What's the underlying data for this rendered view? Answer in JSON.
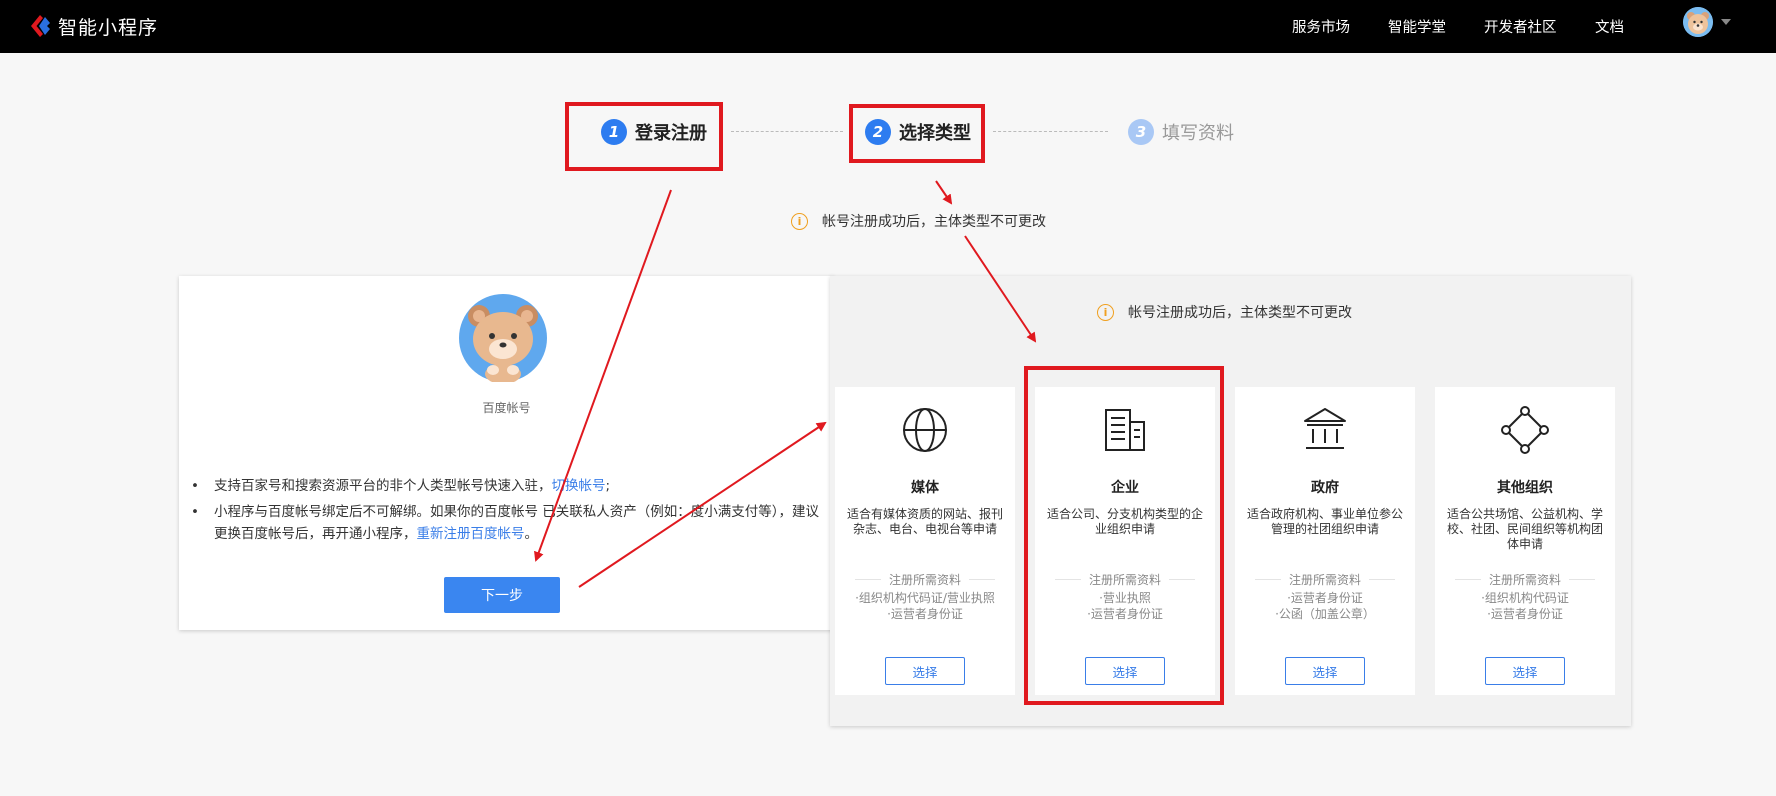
{
  "header": {
    "brand": "智能小程序",
    "nav": [
      "服务市场",
      "智能学堂",
      "开发者社区",
      "文档"
    ]
  },
  "steps": [
    {
      "num": "1",
      "label": "登录注册",
      "state": "done"
    },
    {
      "num": "2",
      "label": "选择类型",
      "state": "active"
    },
    {
      "num": "3",
      "label": "填写资料",
      "state": "pending"
    }
  ],
  "notice": "帐号注册成功后，主体类型不可更改",
  "login_panel": {
    "account_name": "百度帐号",
    "bullet1_text": "支持百家号和搜索资源平台的非个人类型帐号快速入驻，",
    "bullet1_link": "切换帐号",
    "bullet1_end": ";",
    "bullet2_text": "小程序与百度帐号绑定后不可解绑。如果你的百度帐号          已关联私人资产（例如：度小满支付等），建议更换百度帐号后，再开通小程序，",
    "bullet2_link": "重新注册百度帐号",
    "bullet2_end": "。",
    "next_button": "下一步"
  },
  "type_panel": {
    "notice": "帐号注册成功后，主体类型不可更改",
    "required_label": "注册所需资料",
    "cards": [
      {
        "icon": "globe-icon",
        "title": "媒体",
        "desc": "适合有媒体资质的网站、报刊杂志、电台、电视台等申请",
        "reqs": [
          "·组织机构代码证/营业执照",
          "·运营者身份证"
        ],
        "button": "选择"
      },
      {
        "icon": "building-icon",
        "title": "企业",
        "desc": "适合公司、分支机构类型的企业组织申请",
        "reqs": [
          "·营业执照",
          "·运营者身份证"
        ],
        "button": "选择"
      },
      {
        "icon": "government-icon",
        "title": "政府",
        "desc": "适合政府机构、事业单位参公管理的社团组织申请",
        "reqs": [
          "·运营者身份证",
          "·公函（加盖公章）"
        ],
        "button": "选择"
      },
      {
        "icon": "network-icon",
        "title": "其他组织",
        "desc": "适合公共场馆、公益机构、学校、社团、民间组织等机构团体申请",
        "reqs": [
          "·组织机构代码证",
          "·运营者身份证"
        ],
        "button": "选择"
      }
    ]
  },
  "colors": {
    "accent": "#3a86f0",
    "highlight": "#e0191f",
    "warning": "#f0a020",
    "step_pending": "#a9c8f5"
  }
}
